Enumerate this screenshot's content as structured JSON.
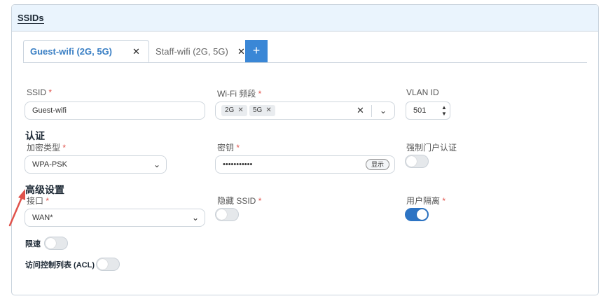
{
  "card": {
    "title": "SSIDs"
  },
  "tabs": [
    {
      "label": "Guest-wifi (2G, 5G)",
      "active": true,
      "close": "✕"
    },
    {
      "label": "Staff-wifi (2G, 5G)",
      "active": false,
      "close": "✕"
    }
  ],
  "tab_add": "+",
  "ssid": {
    "label": "SSID",
    "required": "*",
    "value": "Guest-wifi"
  },
  "bands": {
    "label": "Wi-Fi 频段",
    "required": "*",
    "chips": [
      "2G",
      "5G"
    ],
    "clear": "✕"
  },
  "vlan": {
    "label": "VLAN ID",
    "value": "501"
  },
  "auth": {
    "section": "认证",
    "encryption": {
      "label": "加密类型",
      "required": "*",
      "value": "WPA-PSK"
    },
    "key": {
      "label": "密钥",
      "required": "*",
      "value": "•••••••••••",
      "show_label": "显示"
    },
    "captive": {
      "label": "强制门户认证",
      "enabled": false
    }
  },
  "advanced": {
    "section": "高级设置",
    "interface": {
      "label": "接口",
      "required": "*",
      "value": "WAN*"
    },
    "hide_ssid": {
      "label": "隐藏 SSID",
      "required": "*",
      "enabled": false
    },
    "isolation": {
      "label": "用户隔离",
      "required": "*",
      "enabled": true
    }
  },
  "rate_limit": {
    "label": "限速",
    "enabled": false
  },
  "acl": {
    "label": "访问控制列表 (ACL)",
    "enabled": false
  },
  "colors": {
    "accent": "#3a87d6",
    "toggle_on": "#2d74c4",
    "annotation_arrow": "#e0524b"
  }
}
